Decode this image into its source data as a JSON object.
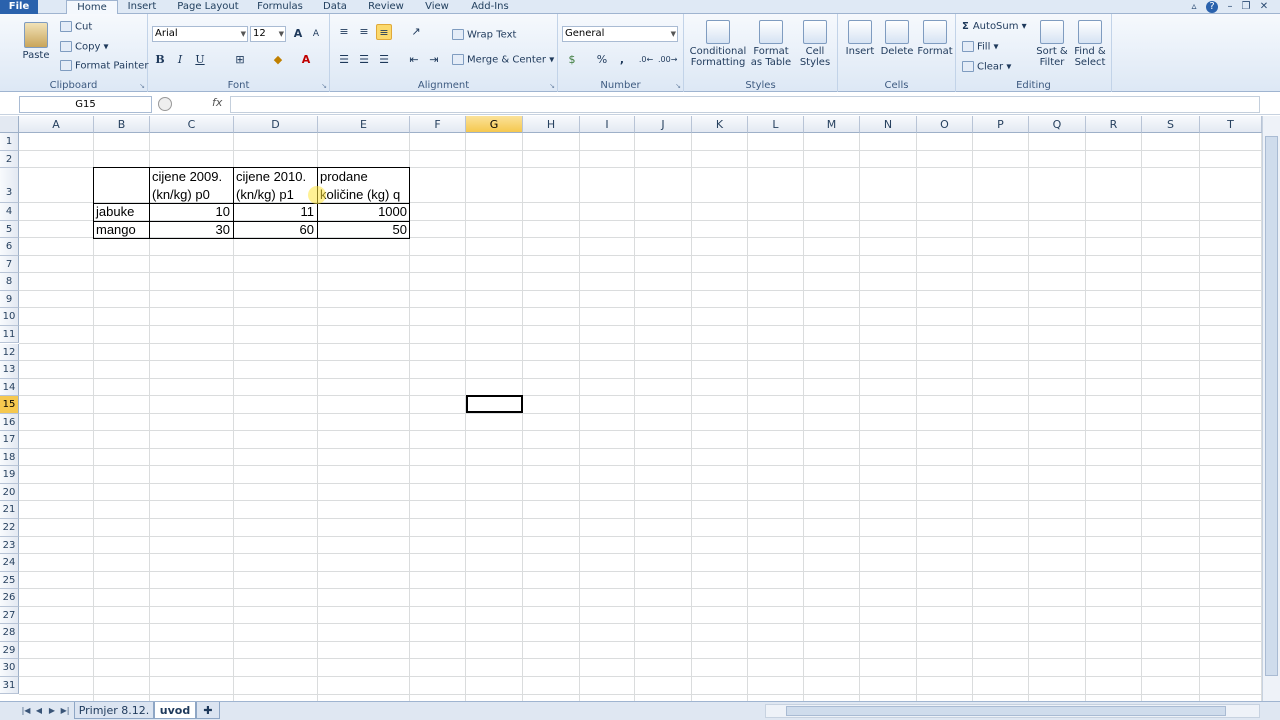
{
  "tabs": {
    "file": "File",
    "home": "Home",
    "insert": "Insert",
    "page_layout": "Page Layout",
    "formulas": "Formulas",
    "data": "Data",
    "review": "Review",
    "view": "View",
    "addins": "Add-Ins"
  },
  "clipboard": {
    "paste": "Paste",
    "cut": "Cut",
    "copy": "Copy",
    "format_painter": "Format Painter",
    "label": "Clipboard"
  },
  "font": {
    "name": "Arial",
    "size": "12",
    "label": "Font",
    "bold": "B",
    "italic": "I",
    "underline": "U"
  },
  "alignment": {
    "wrap_text": "Wrap Text",
    "merge_center": "Merge & Center",
    "label": "Alignment"
  },
  "number": {
    "format": "General",
    "label": "Number",
    "percent": "%",
    "comma": ","
  },
  "styles": {
    "conditional": "Conditional",
    "formatting": "Formatting",
    "format": "Format",
    "as_table": "as Table",
    "cell": "Cell",
    "cell_styles": "Styles",
    "label": "Styles"
  },
  "cells": {
    "insert": "Insert",
    "delete": "Delete",
    "format": "Format",
    "label": "Cells"
  },
  "editing": {
    "autosum": "AutoSum",
    "fill": "Fill",
    "clear": "Clear",
    "sort": "Sort &",
    "filter": "Filter",
    "find": "Find &",
    "select": "Select",
    "label": "Editing"
  },
  "formula_bar": {
    "name_box": "G15",
    "fx": "fx",
    "value": ""
  },
  "columns": [
    "A",
    "B",
    "C",
    "D",
    "E",
    "F",
    "G",
    "H",
    "I",
    "J",
    "K",
    "L",
    "M",
    "N",
    "O",
    "P",
    "Q",
    "R",
    "S",
    "T"
  ],
  "selected_column": "G",
  "rows": [
    "1",
    "2",
    "3",
    "4",
    "5",
    "6",
    "7",
    "8",
    "9",
    "10",
    "11",
    "12",
    "13",
    "14",
    "15",
    "16",
    "17",
    "18",
    "19",
    "20",
    "21",
    "22",
    "23",
    "24",
    "25",
    "26",
    "27",
    "28",
    "29",
    "30",
    "31"
  ],
  "selected_row": "15",
  "cells_data": {
    "c3a": "cijene 2009.",
    "c3b": "(kn/kg) p0",
    "d3a": "cijene 2010.",
    "d3b": "(kn/kg) p1",
    "e3a": "prodane",
    "e3b": "količine (kg) q",
    "b4": "jabuke",
    "c4": "10",
    "d4": "11",
    "e4": "1000",
    "b5": "mango",
    "c5": "30",
    "d5": "60",
    "e5": "50"
  },
  "sheets": [
    "Primjer 8.12.",
    "uvod"
  ],
  "active_sheet": "uvod",
  "colors": {
    "accent": "#2a62ad",
    "selection": "#f5c84f"
  }
}
